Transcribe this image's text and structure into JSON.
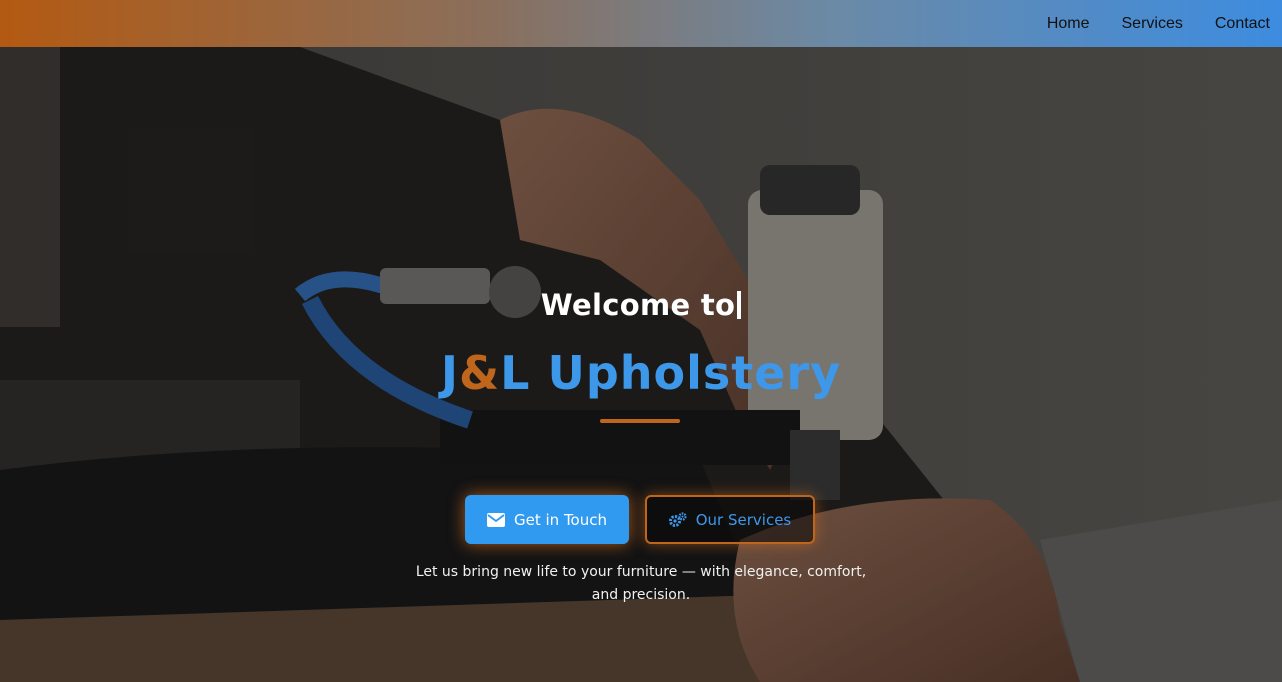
{
  "nav": {
    "items": [
      "Home",
      "Services",
      "Contact"
    ]
  },
  "hero": {
    "welcome_text": "Welcome to",
    "brand": {
      "part1": "J",
      "amp": "&",
      "part2": "L Upholstery"
    },
    "primary_button": {
      "label": "Get in Touch",
      "icon": "envelope-icon"
    },
    "secondary_button": {
      "label": "Our Services",
      "icon": "gears-icon"
    },
    "tagline": "Let us bring new life to your furniture — with elegance, comfort, and precision."
  },
  "colors": {
    "accent_blue": "#3e98ea",
    "accent_orange": "#c0661c",
    "button_blue": "#2f9af0"
  }
}
